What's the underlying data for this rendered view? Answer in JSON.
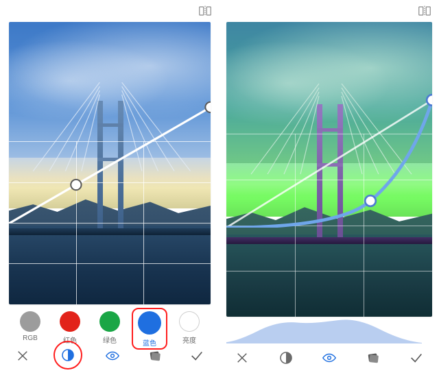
{
  "icons": {
    "flip": "flip-compare-icon",
    "close": "close-icon",
    "contrast": "contrast-icon",
    "eye": "eye-icon",
    "card": "card-icon",
    "check": "check-icon"
  },
  "swatches": [
    {
      "id": "rgb",
      "label": "RGB",
      "color": "#9c9c9c",
      "selected": false
    },
    {
      "id": "red",
      "label": "红色",
      "color": "#e2231a",
      "selected": false
    },
    {
      "id": "green",
      "label": "绿色",
      "color": "#1aa646",
      "selected": false
    },
    {
      "id": "blue",
      "label": "蓝色",
      "color": "#1f6fe0",
      "selected": true
    },
    {
      "id": "lum",
      "label": "亮度",
      "color": "#ffffff",
      "selected": false,
      "outline": "#bdbdbd"
    }
  ],
  "left_panel": {
    "toolbar": {
      "contrast_active": true,
      "eye_active": false
    },
    "curve": {
      "grid": {
        "rows": 4,
        "cols": 3
      },
      "points": [
        {
          "x": 0.0,
          "y": 0.0
        },
        {
          "x": 0.33,
          "y": 0.33
        },
        {
          "x": 1.0,
          "y": 1.0
        }
      ],
      "line": "diagonal-linear",
      "color": "#ffffff"
    }
  },
  "right_panel": {
    "toolbar": {
      "contrast_active": false,
      "eye_active": true
    },
    "curve": {
      "grid": {
        "rows": 4,
        "cols": 3
      },
      "guide_line": "diagonal-linear",
      "points": [
        {
          "x": 0.0,
          "y": 0.0
        },
        {
          "x": 0.7,
          "y": 0.21
        },
        {
          "x": 1.0,
          "y": 1.0
        }
      ],
      "line": "curved-low-blue",
      "color": "#6fa6ea"
    },
    "histogram_color": "#b9cef0"
  }
}
